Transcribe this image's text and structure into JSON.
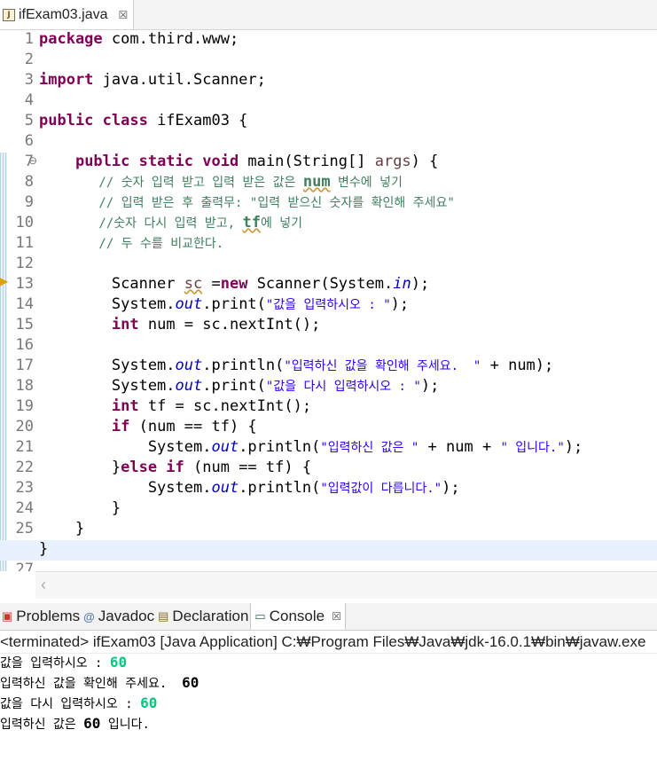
{
  "editor_tab": {
    "title": "ifExam03.java",
    "close": "☒"
  },
  "line_numbers": [
    "1",
    "2",
    "3",
    "4",
    "5",
    "6",
    "7",
    "8",
    "9",
    "10",
    "11",
    "12",
    "13",
    "14",
    "15",
    "16",
    "17",
    "18",
    "19",
    "20",
    "21",
    "22",
    "23",
    "24",
    "25",
    "26",
    "27"
  ],
  "code": {
    "l1_kw": "package",
    "l1_rest": " com.third.www;",
    "l3_kw": "import",
    "l3_rest": " java.util.Scanner;",
    "l5_kw": "public class",
    "l5_rest": " ifExam03 {",
    "l7_indent": "    ",
    "l7_kw": "public static void",
    "l7_rest1": " main(String[] ",
    "l7_var": "args",
    "l7_rest2": ") {",
    "l8_a": "        // 숫자 입력 받고 입력 받은 값은 ",
    "l8_num": "num",
    "l8_b": " 변수에 넣기",
    "l9": "        // 입력 받은 후 출력무: \"입력 받으신 숫자를 확인해 주세요\"",
    "l10_a": "        //숫자 다시 입력 받고, ",
    "l10_tf": "tf",
    "l10_b": "에 넣기",
    "l11": "        // 두 수를 비교한다.",
    "l13_a": "        Scanner ",
    "l13_sc": "sc",
    "l13_b": " =",
    "l13_kw": "new",
    "l13_c": " Scanner(System.",
    "l13_in": "in",
    "l13_d": ");",
    "l14_a": "        System.",
    "l14_out": "out",
    "l14_b": ".print(",
    "l14_str": "\"값을 입력하시오 : \"",
    "l14_c": ");",
    "l15_a": "        ",
    "l15_kw": "int",
    "l15_b": " num = sc.nextInt();",
    "l17_a": "        System.",
    "l17_out": "out",
    "l17_b": ".println(",
    "l17_str": "\"입력하신 값을 확인해 주세요.  \"",
    "l17_c": " + num);",
    "l18_a": "        System.",
    "l18_out": "out",
    "l18_b": ".print(",
    "l18_str": "\"값을 다시 입력하시오 : \"",
    "l18_c": ");",
    "l19_a": "        ",
    "l19_kw": "int",
    "l19_b": " tf = sc.nextInt();",
    "l20_a": "        ",
    "l20_kw": "if",
    "l20_b": " (num == tf) {",
    "l21_a": "            System.",
    "l21_out": "out",
    "l21_b": ".println(",
    "l21_str1": "\"입력하신 값은 \"",
    "l21_c": " + num + ",
    "l21_str2": "\" 입니다.\"",
    "l21_d": ");",
    "l22_a": "        }",
    "l22_kw": "else if",
    "l22_b": " (num == tf) {",
    "l23_a": "            System.",
    "l23_out": "out",
    "l23_b": ".println(",
    "l23_str": "\"입력값이 다릅니다.\"",
    "l23_c": ");",
    "l24": "        }",
    "l25": "    }",
    "l26": "}"
  },
  "views": {
    "problems": "Problems",
    "javadoc": "Javadoc",
    "declaration": "Declaration",
    "console": "Console",
    "close": "☒"
  },
  "console": {
    "terminated": "<terminated> ifExam03 [Java Application] C:₩Program Files₩Java₩jdk-16.0.1₩bin₩javaw.exe",
    "o1_prompt": "값을 입력하시오 : ",
    "o1_input": "60",
    "o2_text": "입력하신 값을 확인해 주세요.  ",
    "o2_value": "60",
    "o3_prompt": "값을 다시 입력하시오 : ",
    "o3_input": "60",
    "o4_a": "입력하신 값은 ",
    "o4_value": "60",
    "o4_b": " 입니다."
  }
}
